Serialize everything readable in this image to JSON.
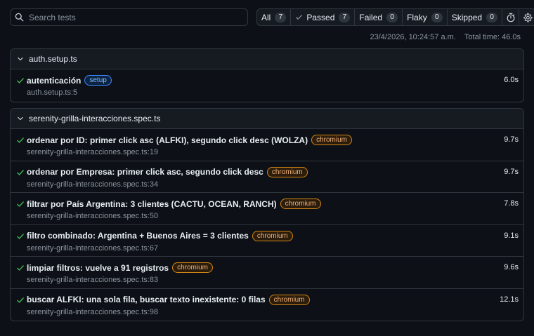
{
  "search": {
    "placeholder": "Search tests"
  },
  "filters": [
    {
      "label": "All",
      "count": "7"
    },
    {
      "label": "Passed",
      "count": "7"
    },
    {
      "label": "Failed",
      "count": "0"
    },
    {
      "label": "Flaky",
      "count": "0"
    },
    {
      "label": "Skipped",
      "count": "0"
    }
  ],
  "toolbar_icons": [
    "stopwatch-icon",
    "gear-icon"
  ],
  "meta": {
    "datetime": "23/4/2026, 10:24:57 a.m.",
    "total_time": "Total time: 46.0s"
  },
  "colors": {
    "pass": "#3fb950",
    "chromium_tag": "#d18616",
    "setup_tag": "#388bfd",
    "background": "#0d1117"
  },
  "groups": [
    {
      "file": "auth.setup.ts",
      "tests": [
        {
          "name": "autenticación",
          "tag": "setup",
          "location": "auth.setup.ts:5",
          "duration": "6.0s"
        }
      ]
    },
    {
      "file": "serenity-grilla-interacciones.spec.ts",
      "tests": [
        {
          "name": "ordenar por ID: primer click asc (ALFKI), segundo click desc (WOLZA)",
          "tag": "chromium",
          "location": "serenity-grilla-interacciones.spec.ts:19",
          "duration": "9.7s"
        },
        {
          "name": "ordenar por Empresa: primer click asc, segundo click desc",
          "tag": "chromium",
          "location": "serenity-grilla-interacciones.spec.ts:34",
          "duration": "9.7s"
        },
        {
          "name": "filtrar por País Argentina: 3 clientes (CACTU, OCEAN, RANCH)",
          "tag": "chromium",
          "location": "serenity-grilla-interacciones.spec.ts:50",
          "duration": "7.8s"
        },
        {
          "name": "filtro combinado: Argentina + Buenos Aires = 3 clientes",
          "tag": "chromium",
          "location": "serenity-grilla-interacciones.spec.ts:67",
          "duration": "9.1s"
        },
        {
          "name": "limpiar filtros: vuelve a 91 registros",
          "tag": "chromium",
          "location": "serenity-grilla-interacciones.spec.ts:83",
          "duration": "9.6s"
        },
        {
          "name": "buscar ALFKI: una sola fila, buscar texto inexistente: 0 filas",
          "tag": "chromium",
          "location": "serenity-grilla-interacciones.spec.ts:98",
          "duration": "12.1s"
        }
      ]
    }
  ]
}
